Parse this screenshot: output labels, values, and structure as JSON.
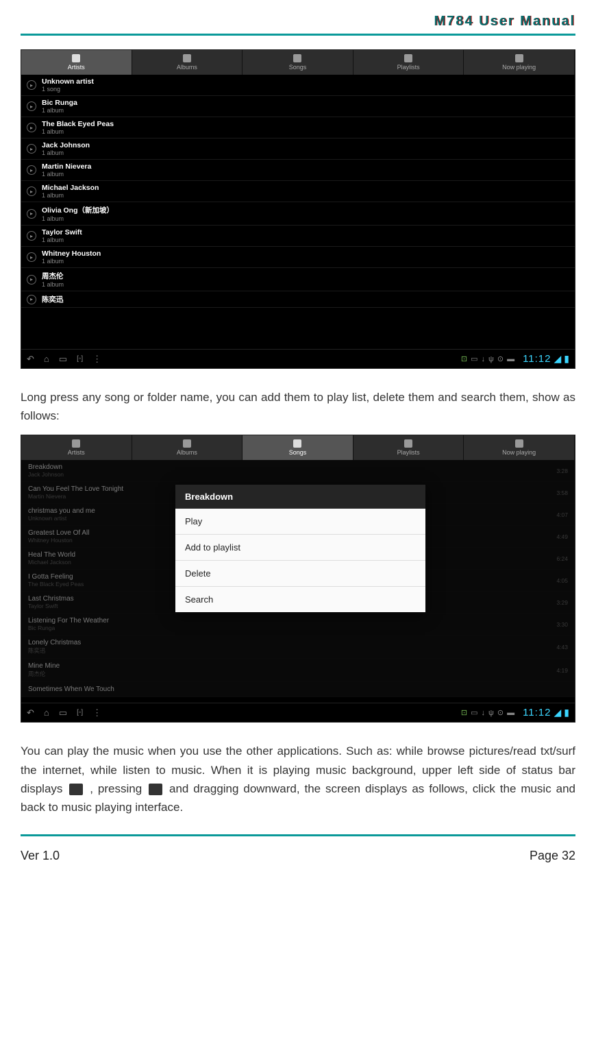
{
  "header": {
    "title": "M784  User  Manual"
  },
  "screenshot1": {
    "tabs": [
      {
        "label": "Artists",
        "active": true
      },
      {
        "label": "Albums",
        "active": false
      },
      {
        "label": "Songs",
        "active": false
      },
      {
        "label": "Playlists",
        "active": false
      },
      {
        "label": "Now playing",
        "active": false
      }
    ],
    "artists": [
      {
        "name": "Unknown artist",
        "sub": "1 song"
      },
      {
        "name": "Bic Runga",
        "sub": "1 album"
      },
      {
        "name": "The Black Eyed Peas",
        "sub": "1 album"
      },
      {
        "name": "Jack Johnson",
        "sub": "1 album"
      },
      {
        "name": "Martin Nievera",
        "sub": "1 album"
      },
      {
        "name": "Michael Jackson",
        "sub": "1 album"
      },
      {
        "name": "Olivia Ong（新加坡）",
        "sub": "1 album"
      },
      {
        "name": "Taylor Swift",
        "sub": "1 album"
      },
      {
        "name": "Whitney Houston",
        "sub": "1 album"
      },
      {
        "name": "周杰伦",
        "sub": "1 album"
      },
      {
        "name": "陈奕迅",
        "sub": ""
      }
    ],
    "time": "11:12"
  },
  "para1": "Long press any song or folder name, you can add them to play list, delete them and search them, show as follows:",
  "screenshot2": {
    "tabs": [
      {
        "label": "Artists",
        "active": false
      },
      {
        "label": "Albums",
        "active": false
      },
      {
        "label": "Songs",
        "active": true
      },
      {
        "label": "Playlists",
        "active": false
      },
      {
        "label": "Now playing",
        "active": false
      }
    ],
    "songs": [
      {
        "title": "Breakdown",
        "artist": "Jack Johnson",
        "dur": "3:28"
      },
      {
        "title": "Can You Feel The Love Tonight",
        "artist": "Martin Nievera",
        "dur": "3:58"
      },
      {
        "title": "christmas you and me",
        "artist": "Unknown artist",
        "dur": "4:07"
      },
      {
        "title": "Greatest Love Of All",
        "artist": "Whitney Houston",
        "dur": "4:49"
      },
      {
        "title": "Heal The World",
        "artist": "Michael Jackson",
        "dur": "6:24"
      },
      {
        "title": "I Gotta Feeling",
        "artist": "The Black Eyed Peas",
        "dur": "4:05"
      },
      {
        "title": "Last Christmas",
        "artist": "Taylor Swift",
        "dur": "3:29"
      },
      {
        "title": "Listening For The Weather",
        "artist": "Bic Runga",
        "dur": "3:30"
      },
      {
        "title": "Lonely Christmas",
        "artist": "陈奕迅",
        "dur": "4:43"
      },
      {
        "title": "Mine Mine",
        "artist": "周杰伦",
        "dur": "4:19"
      },
      {
        "title": "Sometimes When We Touch",
        "artist": "",
        "dur": ""
      }
    ],
    "context": {
      "title": "Breakdown",
      "items": [
        "Play",
        "Add to playlist",
        "Delete",
        "Search"
      ]
    },
    "time": "11:12"
  },
  "para2_a": "You can play the music when you use the other applications. Such as: while browse pictures/read txt/surf the internet, while listen to music. When it is playing music background, upper left side of status bar displays",
  "para2_b": ", pressing",
  "para2_c": "  and dragging downward, the screen displays as follows, click the music and back to music playing interface.",
  "footer": {
    "ver": "Ver 1.0",
    "page": "Page 32"
  }
}
